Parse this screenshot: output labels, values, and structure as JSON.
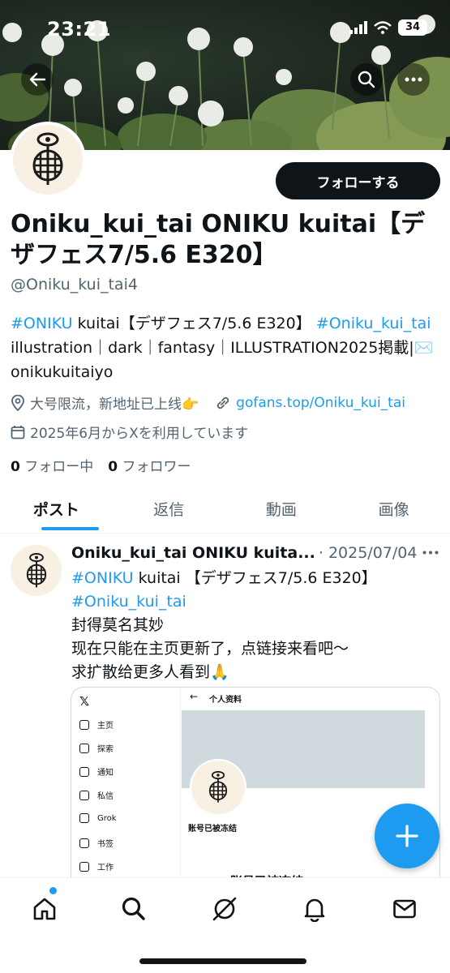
{
  "status_bar": {
    "time": "23:21",
    "battery": "34"
  },
  "header_buttons": {
    "back": "back-arrow-icon",
    "search": "search-icon",
    "more": "more-icon"
  },
  "profile": {
    "follow_label": "フォローする",
    "display_name": "Oniku_kui_tai ONIKU kuitai【デザフェス7/5.6 E320】",
    "handle": "@Oniku_kui_tai4",
    "bio": {
      "tag1": "#ONIKU",
      "text1": " kuitai【デザフェス7/5.6 E320】",
      "tag2": "#Oniku_kui_tai",
      "text2": "illustration｜dark｜fantasy｜ILLUSTRATION2025掲載|✉️onikukuitaiyo"
    },
    "location": "大号限流，新地址已上线👉",
    "website": "gofans.top/Oniku_kui_tai",
    "joined": "2025年6月からXを利用しています",
    "following_count": "0",
    "following_label": "フォロー中",
    "followers_count": "0",
    "followers_label": "フォロワー"
  },
  "tabs": [
    {
      "label": "ポスト",
      "active": true
    },
    {
      "label": "返信",
      "active": false
    },
    {
      "label": "動画",
      "active": false
    },
    {
      "label": "画像",
      "active": false
    }
  ],
  "tweet": {
    "author": "Oniku_kui_tai ONIKU kuita...",
    "date": "· 2025/07/04",
    "tag1": "#ONIKU",
    "line1_rest": " kuitai 【デザフェス7/5.6 E320】",
    "tag2": "#Oniku_kui_tai",
    "line2": "封得莫名其妙",
    "line3": "现在只能在主页更新了，点链接来看吧～",
    "line4": "求扩散给更多人看到🙏"
  },
  "media": {
    "x_logo": "𝕏",
    "nav": [
      "主页",
      "探索",
      "通知",
      "私信",
      "Grok",
      "书签",
      "工作"
    ],
    "back": "←",
    "title": "个人资料",
    "frozen_small": "账号已被冻结",
    "frozen_big": "账号已被冻结"
  },
  "fab": "+",
  "bottom_nav": [
    "home-icon",
    "search-icon",
    "grok-icon",
    "notifications-icon",
    "messages-icon"
  ],
  "colors": {
    "accent": "#1d9bf0",
    "text": "#0f1419",
    "muted": "#536471"
  }
}
